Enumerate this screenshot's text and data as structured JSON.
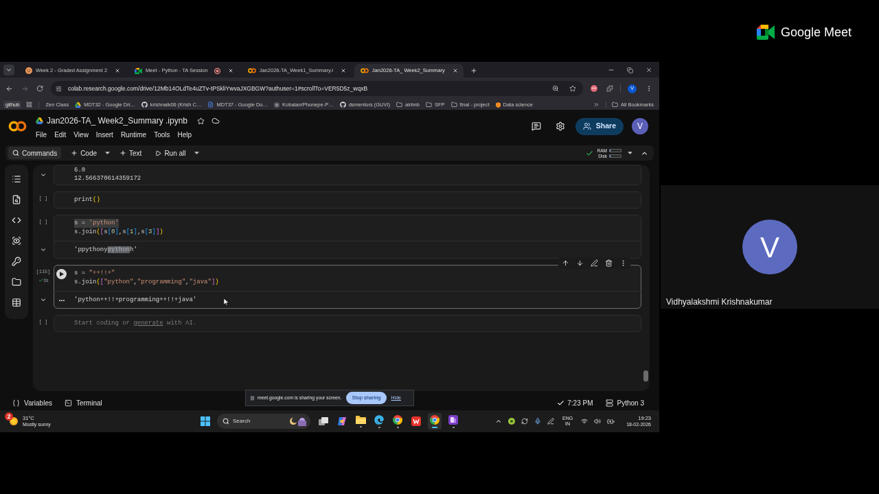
{
  "browser": {
    "tabs": [
      {
        "title": "Week 2 - Graded Assignment 2",
        "kind": "emoji",
        "recording": false,
        "selected": false
      },
      {
        "title": "Meet - Python - TA Session",
        "kind": "meet",
        "recording": true,
        "selected": false
      },
      {
        "title": "Jan2026-TA_Week1_Summary.i",
        "kind": "colab",
        "recording": false,
        "selected": false
      },
      {
        "title": "Jan2026-TA_ Week2_Summary",
        "kind": "colab",
        "recording": false,
        "selected": true
      }
    ],
    "address": "colab.research.google.com/drive/12Mb14OLdTe4uZTv-tPSkliYwvaJXGBGW?authuser=1#scrollTo=VER5D5z_wqxB",
    "profile": "V",
    "bookmarks": [
      {
        "label": "github",
        "kind": "chip"
      },
      {
        "label": "Zen Class",
        "kind": "plain"
      },
      {
        "label": "MDT32 - Google Dri…",
        "kind": "drive"
      },
      {
        "label": "krishnaik06 (Krish C…",
        "kind": "github"
      },
      {
        "label": "MDT37 - Google Do…",
        "kind": "doc"
      },
      {
        "label": "Kobalan/Phonepe-P…",
        "kind": "site"
      },
      {
        "label": "dsmentors (GUVI)",
        "kind": "github"
      },
      {
        "label": "airbnb",
        "kind": "folder"
      },
      {
        "label": "SFP",
        "kind": "folder"
      },
      {
        "label": "final - project",
        "kind": "folder"
      },
      {
        "label": "Data science",
        "kind": "shield"
      }
    ],
    "all_bookmarks": "All Bookmarks"
  },
  "colab": {
    "title": "Jan2026-TA_ Week2_Summary .ipynb",
    "menu": [
      "File",
      "Edit",
      "View",
      "Insert",
      "Runtime",
      "Tools",
      "Help"
    ],
    "share": "Share",
    "avatar": "V",
    "toolbar": [
      {
        "label": "Commands",
        "kind": "search",
        "dropdown": false
      },
      {
        "label": "Code",
        "kind": "add",
        "dropdown": true
      },
      {
        "label": "Text",
        "kind": "add",
        "dropdown": false
      },
      {
        "label": "Run all",
        "kind": "run",
        "dropdown": true
      }
    ],
    "resources": {
      "connected": true,
      "ram": {
        "label": "RAM",
        "level": 0.05
      },
      "disk": {
        "label": "Disk",
        "level": 0.05
      }
    },
    "cells": [
      {
        "kind": "output",
        "active": false,
        "outputs": [
          {
            "segments": [
              {
                "text": "6.0",
                "selected": false
              }
            ]
          },
          {
            "segments": [
              {
                "text": "12.566370614359172",
                "selected": false
              }
            ]
          }
        ]
      },
      {
        "kind": "code",
        "active": false,
        "prompt": "[ ]",
        "code": [
          {
            "text": "print()",
            "selected": false
          }
        ]
      },
      {
        "kind": "code",
        "active": false,
        "prompt": "[ ]",
        "code": [
          {
            "text": "s = 'python'",
            "selected": true
          },
          {
            "text": "s.join([s[0],s[1],s[3]])",
            "selected": false
          }
        ],
        "outputs": [
          {
            "segments": [
              {
                "text": "'ppythony",
                "selected": false
              },
              {
                "text": "python",
                "selected": true
              },
              {
                "text": "h'",
                "selected": false
              }
            ]
          }
        ]
      },
      {
        "kind": "code",
        "active": true,
        "prompt": "[115]",
        "succeeded": true,
        "duration": "0s",
        "code": [
          {
            "text": "s = \"++!!+\"",
            "selected": false
          },
          {
            "text": "s.join([\"python\",\"programming\",\"java\"])",
            "selected": false
          }
        ],
        "outputs": [
          {
            "segments": [
              {
                "text": "'python++!!+programming++!!+java'",
                "selected": false
              }
            ]
          }
        ]
      },
      {
        "kind": "code",
        "active": false,
        "prompt": "[ ]",
        "placeholder": {
          "start": "Start coding or ",
          "link": "generate",
          "end": " with AI."
        }
      }
    ],
    "status_bar": {
      "variables": "Variables",
      "terminal": "Terminal",
      "last_run": "7:23 PM",
      "runtime": "Python 3"
    }
  },
  "share_banner": {
    "message": "meet.google.com is sharing your screen.",
    "stop": "Stop sharing",
    "hide": "Hide"
  },
  "taskbar": {
    "weather": {
      "badge": "2",
      "temperature": "31°C",
      "condition": "Mostly sunny"
    },
    "search": {
      "placeholder": "Search"
    },
    "apps": [
      {
        "kind": "taskview",
        "running": false,
        "selected": false
      },
      {
        "kind": "copilot",
        "running": false,
        "selected": false
      },
      {
        "kind": "files",
        "running": true,
        "selected": false
      },
      {
        "kind": "edge",
        "running": true,
        "selected": false
      },
      {
        "kind": "chrome",
        "running": true,
        "selected": false
      },
      {
        "kind": "wps",
        "running": false,
        "selected": false
      },
      {
        "kind": "chrome",
        "running": true,
        "selected": true
      },
      {
        "kind": "notes",
        "running": true,
        "selected": false
      }
    ],
    "language": "ENG",
    "region": "IN",
    "time": "19:23",
    "date": "18-02-2026"
  },
  "meet": {
    "brand": "Google Meet",
    "participant": {
      "initial": "V",
      "name": "Vidhyalakshmi Krishnakumar"
    }
  }
}
